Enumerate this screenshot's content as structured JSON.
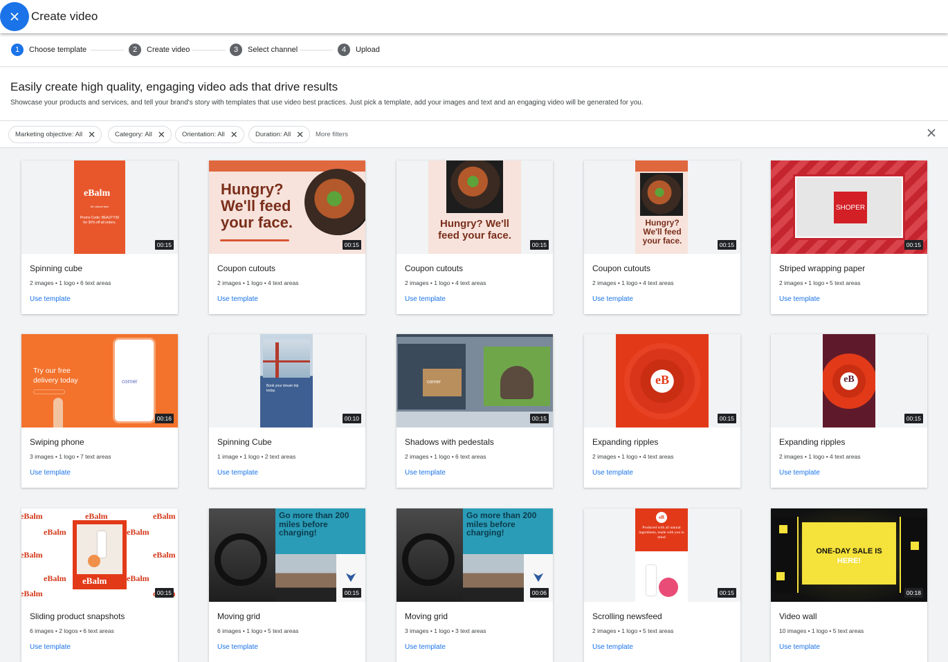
{
  "header": {
    "title": "Create video"
  },
  "steps": [
    {
      "num": "1",
      "label": "Choose template",
      "active": true
    },
    {
      "num": "2",
      "label": "Create video",
      "active": false
    },
    {
      "num": "3",
      "label": "Select channel",
      "active": false
    },
    {
      "num": "4",
      "label": "Upload",
      "active": false
    }
  ],
  "intro": {
    "title": "Easily create high quality, engaging video ads that drive results",
    "description": "Showcase your products and services, and tell your brand's story with templates that use video best practices. Just pick a template, add your images and text and an engaging video will be generated for you."
  },
  "filters": {
    "chips": [
      "Marketing objective: All",
      "Category: All",
      "Orientation: All",
      "Duration: All"
    ],
    "more": "More filters"
  },
  "colors": {
    "accent": "#1a73e8",
    "background": "#f1f3f4"
  },
  "card_action_label": "Use template",
  "templates": [
    {
      "title": "Spinning cube",
      "meta": "2 images • 1 logo • 6 text areas",
      "duration": "00:15",
      "thumb_text": {
        "logo": "eBalm",
        "tagline": "All natural face",
        "promo": "Promo Code: BEAUTY30 for 30% off all orders."
      }
    },
    {
      "title": "Coupon cutouts",
      "meta": "2 images • 1 logo • 4 text areas",
      "duration": "00:15",
      "thumb_text": {
        "headline": "Hungry? We'll feed your face."
      }
    },
    {
      "title": "Coupon cutouts",
      "meta": "2 images • 1 logo • 4 text areas",
      "duration": "00:15",
      "thumb_text": {
        "headline": "Hungry? We'll feed your face."
      }
    },
    {
      "title": "Coupon cutouts",
      "meta": "2 images • 1 logo • 4 text areas",
      "duration": "00:15",
      "thumb_text": {
        "headline": "Hungry? We'll feed your face."
      }
    },
    {
      "title": "Striped wrapping paper",
      "meta": "2 images • 1 logo • 5 text areas",
      "duration": "00:15",
      "thumb_text": {
        "logo": "SHOPER"
      }
    },
    {
      "title": "Swiping phone",
      "meta": "3 images • 1 logo • 7 text areas",
      "duration": "00:16",
      "thumb_text": {
        "headline": "Try our free delivery today",
        "logo": "corner"
      }
    },
    {
      "title": "Spinning Cube",
      "meta": "1 image • 1 logo • 2 text areas",
      "duration": "00:10",
      "thumb_text": {
        "headline": "Book your dream trip today."
      }
    },
    {
      "title": "Shadows with pedestals",
      "meta": "2 images • 1 logo • 6 text areas",
      "duration": "00:15",
      "thumb_text": {
        "logo": "corner"
      }
    },
    {
      "title": "Expanding ripples",
      "meta": "2 images • 1 logo • 4 text areas",
      "duration": "00:15",
      "thumb_text": {
        "logo": "eB"
      }
    },
    {
      "title": "Expanding ripples",
      "meta": "2 images • 1 logo • 4 text areas",
      "duration": "00:15",
      "thumb_text": {
        "logo": "eB"
      }
    },
    {
      "title": "Sliding product snapshots",
      "meta": "6 images • 2 logos • 6 text areas",
      "duration": "00:15",
      "thumb_text": {
        "logo": "eBalm"
      }
    },
    {
      "title": "Moving grid",
      "meta": "6 images • 1 logo • 5 text areas",
      "duration": "00:15",
      "thumb_text": {
        "headline": "Go more than 200 miles before charging!"
      }
    },
    {
      "title": "Moving grid",
      "meta": "3 images • 1 logo • 3 text areas",
      "duration": "00:06",
      "thumb_text": {
        "headline": "Go more than 200 miles before charging!"
      }
    },
    {
      "title": "Scrolling newsfeed",
      "meta": "2 images • 1 logo • 5 text areas",
      "duration": "00:15",
      "thumb_text": {
        "logo": "eB",
        "headline": "Produced with all natural ingredients, made with you in mind"
      }
    },
    {
      "title": "Video wall",
      "meta": "10 images • 1 logo • 5 text areas",
      "duration": "00:18",
      "thumb_text": {
        "headline": "ONE-DAY SALE IS",
        "highlight": "HERE!"
      }
    }
  ]
}
